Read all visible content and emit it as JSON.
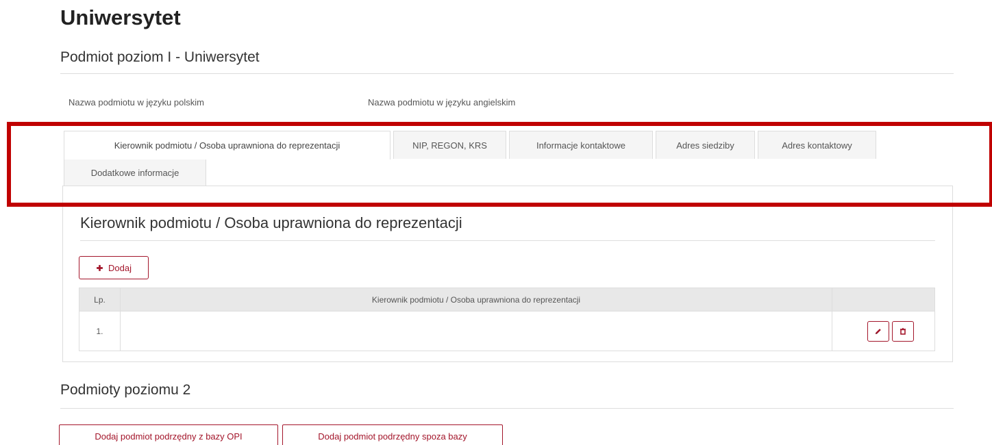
{
  "page": {
    "title": "Uniwersytet",
    "subtitle": "Podmiot poziom I - Uniwersytet"
  },
  "fields": {
    "name_pl_label": "Nazwa podmiotu w języku polskim",
    "name_en_label": "Nazwa podmiotu w języku angielskim"
  },
  "tabs": [
    {
      "label": "Kierownik podmiotu / Osoba uprawniona do reprezentacji",
      "active": true
    },
    {
      "label": "NIP, REGON, KRS"
    },
    {
      "label": "Informacje kontaktowe"
    },
    {
      "label": "Adres siedziby"
    },
    {
      "label": "Adres kontaktowy"
    },
    {
      "label": "Dodatkowe informacje"
    }
  ],
  "panel": {
    "title": "Kierownik podmiotu / Osoba uprawniona do reprezentacji",
    "add_label": "Dodaj",
    "table": {
      "headers": [
        "Lp.",
        "Kierownik podmiotu / Osoba uprawniona do reprezentacji",
        ""
      ],
      "rows": [
        {
          "lp": "1.",
          "name": ""
        }
      ]
    }
  },
  "level2": {
    "title": "Podmioty poziomu 2",
    "buttons": [
      "Dodaj podmiot podrzędny z bazy OPI",
      "Dodaj podmiot podrzędny spoza bazy"
    ]
  },
  "colors": {
    "accent": "#a3152a",
    "highlight": "#c00000"
  },
  "icons": [
    "plus-icon",
    "pencil-icon",
    "trash-icon"
  ]
}
